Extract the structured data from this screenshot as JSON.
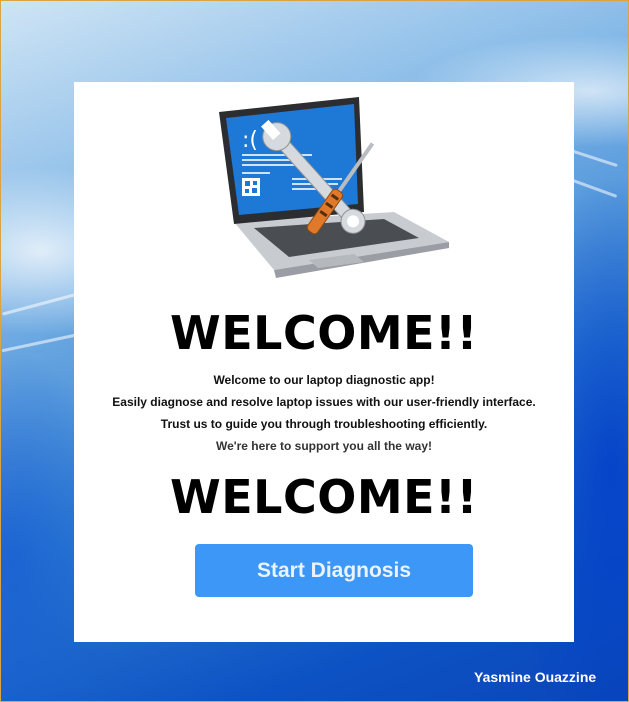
{
  "hero": {
    "icon": "laptop-repair-illustration",
    "screen_face": ":(",
    "colors": {
      "screen": "#1e78d6",
      "body": "#c8cbd0",
      "keyboard": "#4a4d52"
    }
  },
  "welcome": {
    "title_top": "WELCOME!!",
    "title_bottom": "WELCOME!!"
  },
  "intro": {
    "line1": "Welcome to our laptop diagnostic app!",
    "line2": "Easily diagnose and resolve laptop issues with our user-friendly interface.",
    "line3": "Trust us to guide you through troubleshooting efficiently.",
    "line4": "We're here to support you all the way!"
  },
  "actions": {
    "start_label": "Start Diagnosis",
    "start_color": "#3d97f6"
  },
  "footer": {
    "author": "Yasmine Ouazzine"
  }
}
